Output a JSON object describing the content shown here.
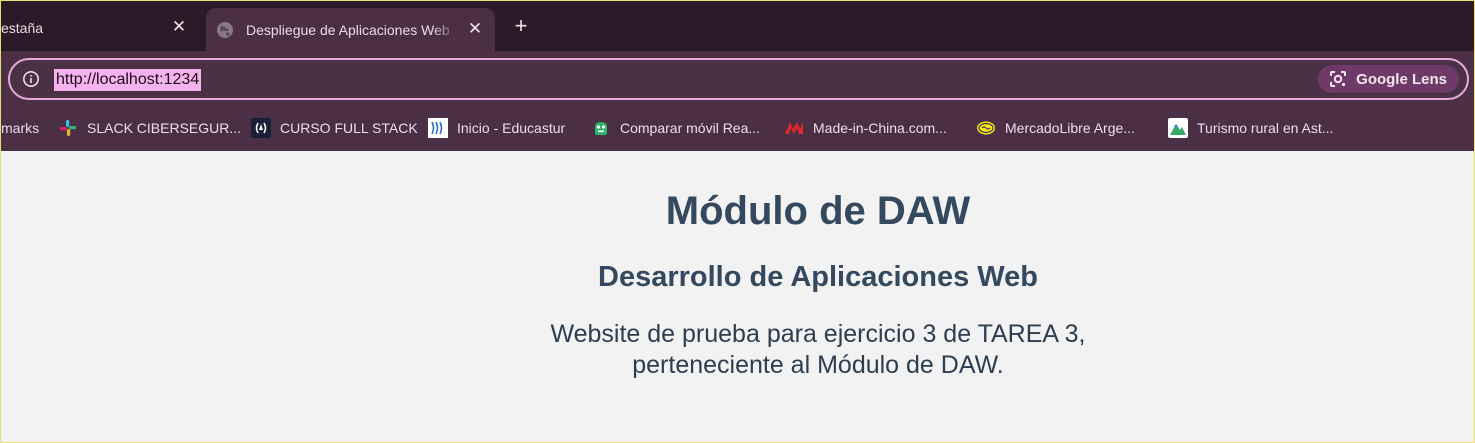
{
  "browser": {
    "tabs": [
      {
        "title": "estaña",
        "close": "✕"
      },
      {
        "title": "Despliegue de Aplicaciones Web",
        "close": "✕"
      }
    ],
    "new_tab": "+",
    "address": {
      "url": "http://localhost:1234",
      "lens_label": "Google Lens"
    },
    "bookmarks": [
      {
        "label": "marks"
      },
      {
        "label": "SLACK CIBERSEGUR..."
      },
      {
        "label": "CURSO FULL STACK"
      },
      {
        "label": "Inicio - Educastur"
      },
      {
        "label": "Comparar móvil Rea..."
      },
      {
        "label": "Made-in-China.com..."
      },
      {
        "label": "MercadoLibre Arge..."
      },
      {
        "label": "Turismo rural en Ast..."
      }
    ]
  },
  "page": {
    "heading": "Módulo de DAW",
    "subheading": "Desarrollo de Aplicaciones Web",
    "paragraph_line1": "Website de prueba para ejercicio 3 de TAREA 3,",
    "paragraph_line2": "perteneciente al Módulo de DAW."
  },
  "colors": {
    "tabstrip": "#2b1a28",
    "toolbar": "#4b3045",
    "omnibox_border": "#e7a8dc",
    "url_highlight": "#f5b3ee",
    "page_background": "#f2f2f2",
    "heading_text": "#34495e"
  }
}
